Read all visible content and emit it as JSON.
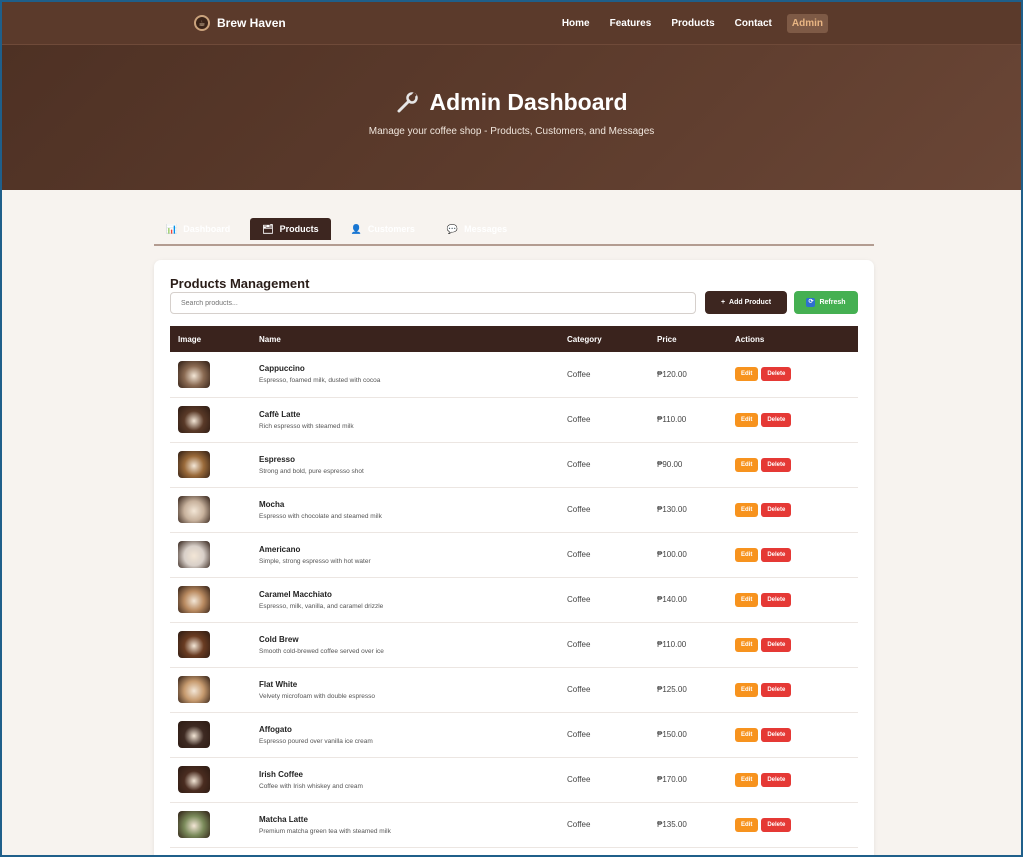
{
  "nav": {
    "brand": "Brew Haven",
    "links": [
      "Home",
      "Features",
      "Products",
      "Contact",
      "Admin"
    ],
    "active": "Admin"
  },
  "hero": {
    "title": "Admin Dashboard",
    "subtitle": "Manage your coffee shop - Products, Customers, and Messages"
  },
  "tabs": [
    {
      "label": "Dashboard",
      "icon": "chart-icon"
    },
    {
      "label": "Products",
      "icon": "products-icon"
    },
    {
      "label": "Customers",
      "icon": "customers-icon"
    },
    {
      "label": "Messages",
      "icon": "messages-icon"
    }
  ],
  "products": {
    "title": "Products Management",
    "search_placeholder": "Search products...",
    "add_label": "Add Product",
    "refresh_label": "Refresh",
    "columns": [
      "Image",
      "Name",
      "Category",
      "Price",
      "Actions"
    ],
    "edit_label": "Edit",
    "delete_label": "Delete",
    "rows": [
      {
        "name": "Cappuccino",
        "desc": "Espresso, foamed milk, dusted with cocoa",
        "category": "Coffee",
        "price": "₱120.00",
        "color": "#8a6a52"
      },
      {
        "name": "Caffè Latte",
        "desc": "Rich espresso with steamed milk",
        "category": "Coffee",
        "price": "₱110.00",
        "color": "#5a3a28"
      },
      {
        "name": "Espresso",
        "desc": "Strong and bold, pure espresso shot",
        "category": "Coffee",
        "price": "₱90.00",
        "color": "#9a6a3a"
      },
      {
        "name": "Mocha",
        "desc": "Espresso with chocolate and steamed milk",
        "category": "Coffee",
        "price": "₱130.00",
        "color": "#c7b19c"
      },
      {
        "name": "Americano",
        "desc": "Simple, strong espresso with hot water",
        "category": "Coffee",
        "price": "₱100.00",
        "color": "#d8cfc8"
      },
      {
        "name": "Caramel Macchiato",
        "desc": "Espresso, milk, vanilla, and caramel drizzle",
        "category": "Coffee",
        "price": "₱140.00",
        "color": "#b98a60"
      },
      {
        "name": "Cold Brew",
        "desc": "Smooth cold-brewed coffee served over ice",
        "category": "Coffee",
        "price": "₱110.00",
        "color": "#6a3c22"
      },
      {
        "name": "Flat White",
        "desc": "Velvety microfoam with double espresso",
        "category": "Coffee",
        "price": "₱125.00",
        "color": "#c69a6e"
      },
      {
        "name": "Affogato",
        "desc": "Espresso poured over vanilla ice cream",
        "category": "Coffee",
        "price": "₱150.00",
        "color": "#3e2a22"
      },
      {
        "name": "Irish Coffee",
        "desc": "Coffee with Irish whiskey and cream",
        "category": "Coffee",
        "price": "₱170.00",
        "color": "#4a2c20"
      },
      {
        "name": "Matcha Latte",
        "desc": "Premium matcha green tea with steamed milk",
        "category": "Coffee",
        "price": "₱135.00",
        "color": "#7a8a5a"
      }
    ]
  }
}
